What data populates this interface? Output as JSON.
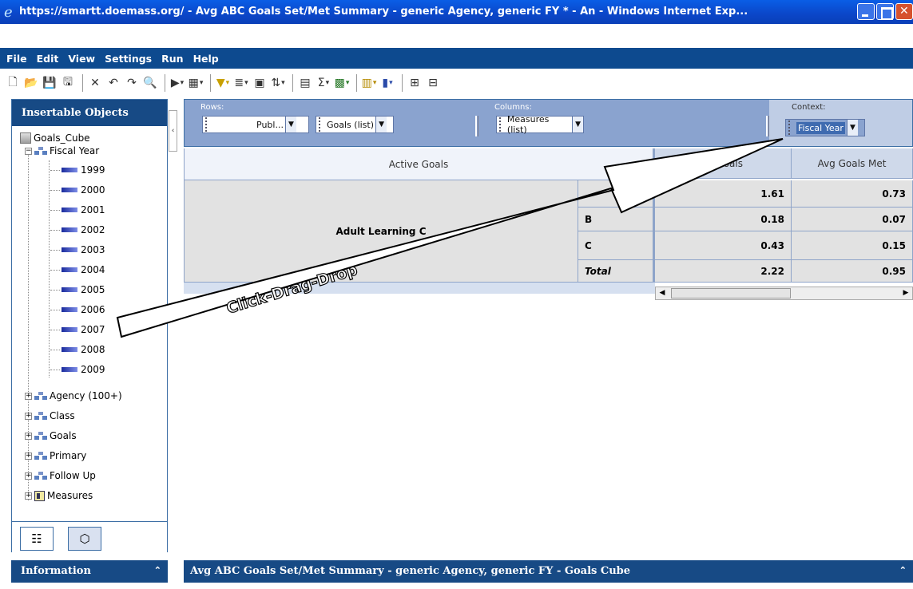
{
  "window": {
    "title": "https://smartt.doemass.org/ - Avg ABC Goals Set/Met Summary - generic Agency, generic FY * - An - Windows Internet Exp..."
  },
  "menu": [
    "File",
    "Edit",
    "View",
    "Settings",
    "Run",
    "Help"
  ],
  "toolbar": {
    "icons": [
      "new-icon",
      "open-icon",
      "save-icon",
      "save-as-icon",
      "delete-icon",
      "undo-icon",
      "redo-icon",
      "find-icon",
      "run-icon",
      "export-icon",
      "filter-icon",
      "rank-icon",
      "calc-icon",
      "sort-icon",
      "summary-icon",
      "sum-icon",
      "excel-icon",
      "chart-icon",
      "bar-chart-icon",
      "layout-icon",
      "pivot-icon"
    ]
  },
  "left_panel": {
    "title": "Insertable Objects",
    "cube": "Goals_Cube",
    "fiscal_year": "Fiscal Year",
    "years": [
      "1999",
      "2000",
      "2001",
      "2002",
      "2003",
      "2004",
      "2005",
      "2006",
      "2007",
      "2008",
      "2009"
    ],
    "dimensions": [
      "Agency (100+)",
      "Class",
      "Goals",
      "Primary",
      "Follow Up",
      "Measures"
    ]
  },
  "info_bar": {
    "title": "Information"
  },
  "dropzones": {
    "rows_label": "Rows:",
    "columns_label": "Columns:",
    "context_label": "Context:",
    "rows_chip1": "Publ...",
    "rows_chip2": "Goals (list)",
    "columns_chip": "Measures (list)",
    "context_chip": "Fiscal Year"
  },
  "grid": {
    "header_left": "Active Goals",
    "header_col1": "oals",
    "header_col2": "Avg Goals Met",
    "row_group": "Adult Learning C",
    "rows": [
      {
        "label": "",
        "v1": "1.61",
        "v2": "0.73"
      },
      {
        "label": "B",
        "v1": "0.18",
        "v2": "0.07"
      },
      {
        "label": "C",
        "v1": "0.43",
        "v2": "0.15"
      },
      {
        "label": "Total",
        "v1": "2.22",
        "v2": "0.95"
      }
    ]
  },
  "annotation": {
    "text": "Click-Drag-Drop"
  },
  "bottom_bar": {
    "title": "Avg ABC Goals Set/Met Summary - generic Agency, generic FY - Goals Cube"
  }
}
